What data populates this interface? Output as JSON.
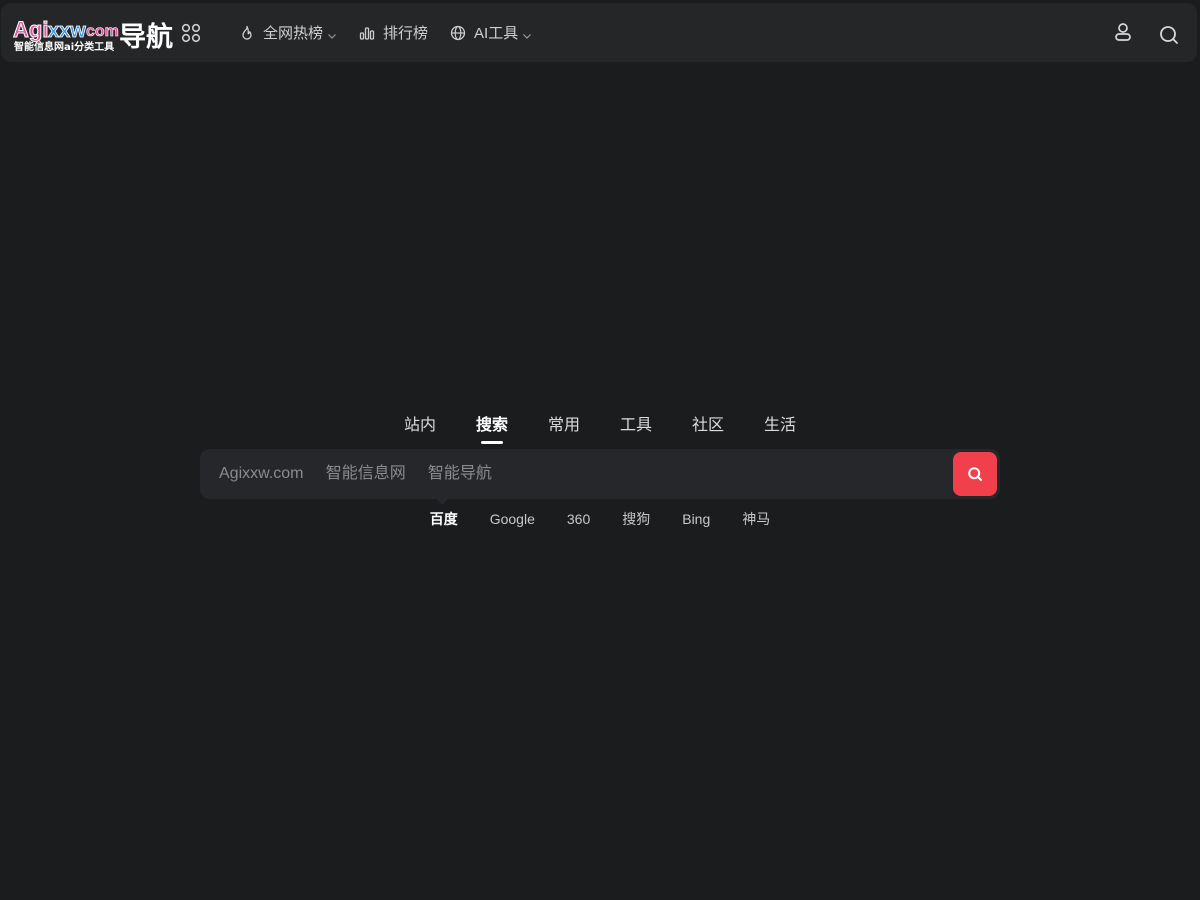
{
  "header": {
    "logo": {
      "part_a": "Agi",
      "part_b": "xxw",
      "part_c": "com",
      "suffix": "导航",
      "tagline": "智能信息网ai分类工具"
    },
    "apps_icon": "grid-icon",
    "nav": [
      {
        "label": "全网热榜",
        "icon": "fire-icon",
        "dropdown": true
      },
      {
        "label": "排行榜",
        "icon": "bar-chart-icon",
        "dropdown": false
      },
      {
        "label": "AI工具",
        "icon": "globe-icon",
        "dropdown": true
      }
    ],
    "user_icon": "user-icon",
    "search_icon": "search-icon"
  },
  "search": {
    "tabs": [
      "站内",
      "搜索",
      "常用",
      "工具",
      "社区",
      "生活"
    ],
    "active_tab": "搜索",
    "placeholder": "Agixxw.com     智能信息网     智能导航",
    "engines": [
      "百度",
      "Google",
      "360",
      "搜狗",
      "Bing",
      "神马"
    ],
    "active_engine": "百度"
  },
  "colors": {
    "background": "#1b1c1e",
    "header_bg": "#252628",
    "search_bg": "#25272a",
    "accent_red": "#f1404b",
    "logo_pink": "#e2559a",
    "logo_blue": "#3a8fe0"
  }
}
